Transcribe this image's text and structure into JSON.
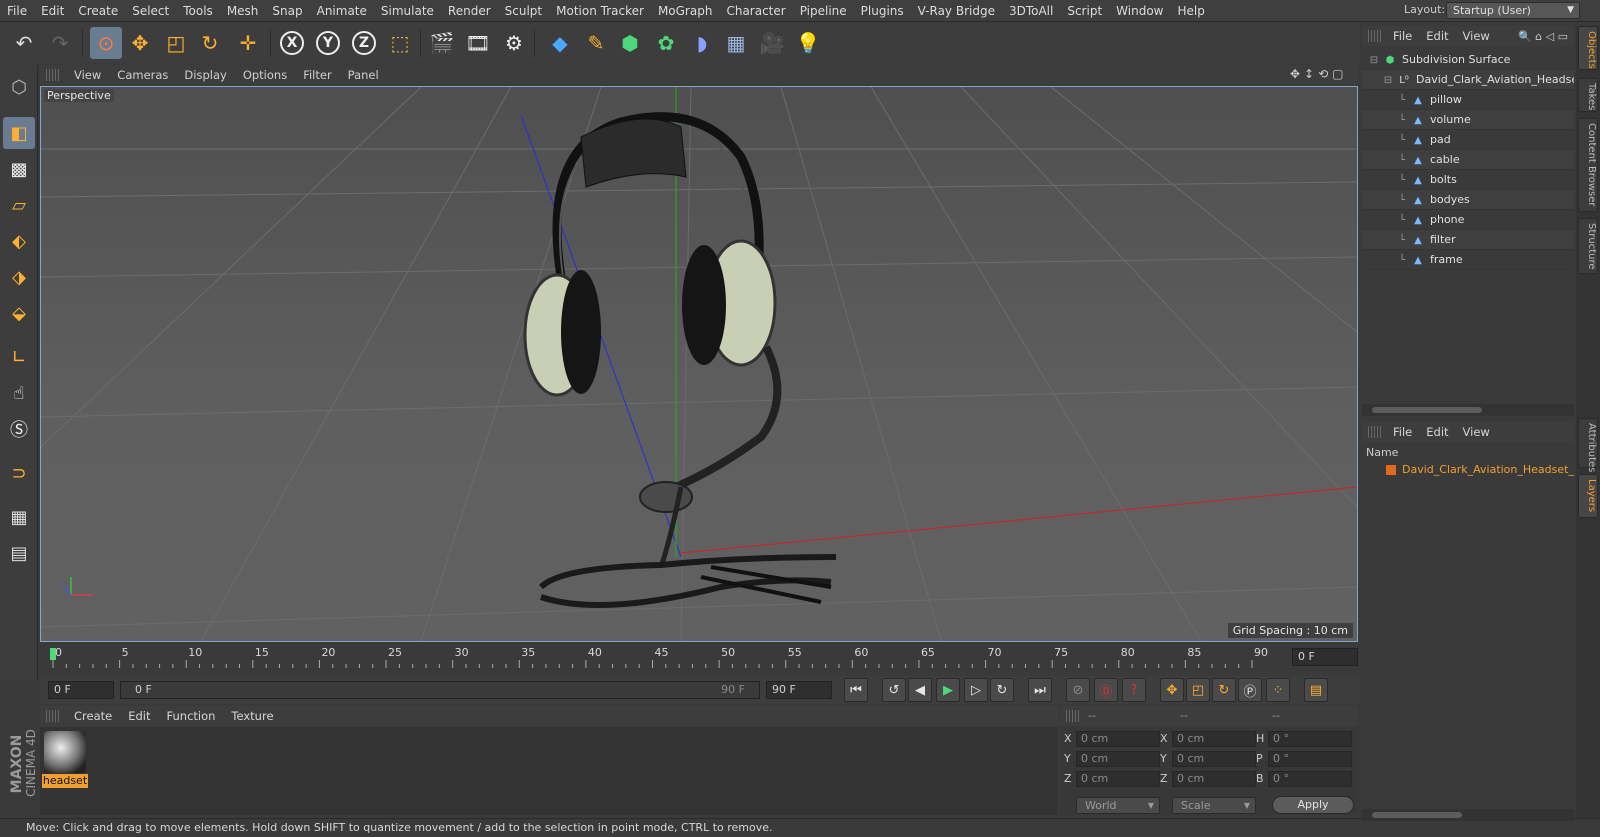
{
  "menu": [
    "File",
    "Edit",
    "Create",
    "Select",
    "Tools",
    "Mesh",
    "Snap",
    "Animate",
    "Simulate",
    "Render",
    "Sculpt",
    "Motion Tracker",
    "MoGraph",
    "Character",
    "Pipeline",
    "Plugins",
    "V-Ray Bridge",
    "3DToAll",
    "Script",
    "Window",
    "Help"
  ],
  "layout": {
    "label": "Layout:",
    "value": "Startup (User)"
  },
  "viewport": {
    "menu": [
      "View",
      "Cameras",
      "Display",
      "Options",
      "Filter",
      "Panel"
    ],
    "label": "Perspective",
    "grid_spacing": "Grid Spacing : 10 cm"
  },
  "timeline": {
    "ticks": [
      "0",
      "5",
      "10",
      "15",
      "20",
      "25",
      "30",
      "35",
      "40",
      "45",
      "50",
      "55",
      "60",
      "65",
      "70",
      "75",
      "80",
      "85",
      "90"
    ],
    "current_frame": "0 F"
  },
  "transport": {
    "start_field": "0 F",
    "range_start": "0 F",
    "range_end": "90 F",
    "end_field": "90 F"
  },
  "material_manager": {
    "menu": [
      "Create",
      "Edit",
      "Function",
      "Texture"
    ],
    "material_name": "headset"
  },
  "coordinates": {
    "header_cols": [
      "--",
      "--",
      "--"
    ],
    "rows": [
      {
        "a_label": "X",
        "a_val": "0 cm",
        "b_label": "X",
        "b_val": "0 cm",
        "c_label": "H",
        "c_val": "0 °"
      },
      {
        "a_label": "Y",
        "a_val": "0 cm",
        "b_label": "Y",
        "b_val": "0 cm",
        "c_label": "P",
        "c_val": "0 °"
      },
      {
        "a_label": "Z",
        "a_val": "0 cm",
        "b_label": "Z",
        "b_val": "0 cm",
        "c_label": "B",
        "c_val": "0 °"
      }
    ],
    "space": "World",
    "mode": "Scale",
    "apply": "Apply"
  },
  "status": "Move: Click and drag to move elements. Hold down SHIFT to quantize movement / add to the selection in point mode, CTRL to remove.",
  "objects_panel": {
    "menu": [
      "File",
      "Edit",
      "View"
    ],
    "tree": [
      {
        "name": "Subdivision Surface",
        "level": 0
      },
      {
        "name": "David_Clark_Aviation_Headset_H",
        "level": 1
      },
      {
        "name": "pillow",
        "level": 2
      },
      {
        "name": "volume",
        "level": 2
      },
      {
        "name": "pad",
        "level": 2
      },
      {
        "name": "cable",
        "level": 2
      },
      {
        "name": "bolts",
        "level": 2
      },
      {
        "name": "bodyes",
        "level": 2
      },
      {
        "name": "phone",
        "level": 2
      },
      {
        "name": "filter",
        "level": 2
      },
      {
        "name": "frame",
        "level": 2
      }
    ]
  },
  "layers_panel": {
    "menu": [
      "File",
      "Edit",
      "View"
    ],
    "column": "Name",
    "layer": "David_Clark_Aviation_Headset_Ha"
  },
  "side_tabs": [
    "Objects",
    "Takes",
    "Content Browser",
    "Structure",
    "Attributes",
    "Layers"
  ],
  "maxon": {
    "line1": "MAXON",
    "line2": "CINEMA 4D"
  },
  "colors": {
    "accent": "#f0a030",
    "selection": "#6a7c92",
    "viewport_border": "#7ea7d6"
  }
}
